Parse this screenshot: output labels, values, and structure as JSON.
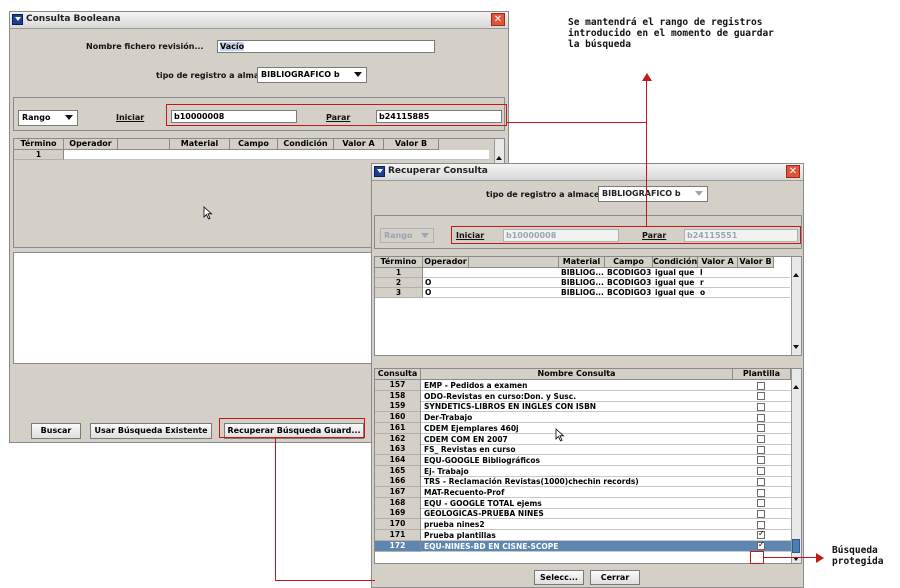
{
  "annotations": {
    "top_note_lines": [
      "Se mantendrá el rango de registros",
      "introducido en el momento de guardar",
      "la búsqueda"
    ],
    "bottom_note_lines": [
      "Búsqueda",
      "protegida"
    ]
  },
  "win1": {
    "title": "Consulta Booleana",
    "revision_label": "Nombre fichero revisión...",
    "revision_value": "Vacío",
    "record_type_label": "tipo de registro a almace...",
    "record_type_value": "BIBLIOGRAFICO b",
    "range_label": "Rango",
    "start_label": "Iniciar",
    "start_value": "b10000008",
    "stop_label": "Parar",
    "stop_value": "b24115885",
    "columns": [
      "Término",
      "Operador",
      "",
      "Material",
      "Campo",
      "Condición",
      "Valor A",
      "Valor B"
    ],
    "first_row_num": "1",
    "buttons": {
      "search": "Buscar",
      "use_existing": "Usar Búsqueda Existente",
      "recover": "Recuperar Búsqueda Guard..."
    }
  },
  "win2": {
    "title": "Recuperar Consulta",
    "record_type_label": "tipo de registro a almace...",
    "record_type_value": "BIBLIOGRAFICO b",
    "range_label": "Rango",
    "start_label": "Iniciar",
    "start_value": "b10000008",
    "stop_label": "Parar",
    "stop_value": "b24115551",
    "columns": [
      "Término",
      "Operador",
      "",
      "Material",
      "Campo",
      "Condición",
      "Valor A",
      "Valor B"
    ],
    "rows": [
      {
        "term": "1",
        "op": "",
        "material": "BIBLIOG...",
        "campo": "BCODIGO3",
        "cond": "igual que",
        "va": "l",
        "vb": ""
      },
      {
        "term": "2",
        "op": "O",
        "material": "BIBLIOG...",
        "campo": "BCODIGO3",
        "cond": "igual que",
        "va": "r",
        "vb": ""
      },
      {
        "term": "3",
        "op": "O",
        "material": "BIBLIOG...",
        "campo": "BCODIGO3",
        "cond": "igual que",
        "va": "o",
        "vb": ""
      }
    ],
    "query_columns": [
      "Consulta",
      "Nombre Consulta",
      "Plantilla"
    ],
    "queries": [
      {
        "num": "157",
        "name": "EMP - Pedidos a examen",
        "template": false
      },
      {
        "num": "158",
        "name": "ODO-Revistas en curso:Don. y Susc.",
        "template": false
      },
      {
        "num": "159",
        "name": "SYNDETICS-LIBROS EN INGLES CON ISBN",
        "template": false
      },
      {
        "num": "160",
        "name": "Der-Trabajo",
        "template": false
      },
      {
        "num": "161",
        "name": "CDEM Ejemplares 460j",
        "template": false
      },
      {
        "num": "162",
        "name": "CDEM COM EN 2007",
        "template": false
      },
      {
        "num": "163",
        "name": "FS_ Revistas en curso",
        "template": false
      },
      {
        "num": "164",
        "name": "EQU-GOOGLE Bibliográficos",
        "template": false
      },
      {
        "num": "165",
        "name": "Ej- Trabajo",
        "template": false
      },
      {
        "num": "166",
        "name": "TRS - Reclamación Revistas(1000)chechin records)",
        "template": false
      },
      {
        "num": "167",
        "name": "MAT-Recuento-Prof",
        "template": false
      },
      {
        "num": "168",
        "name": "EQU - GOOGLE TOTAL ejems",
        "template": false
      },
      {
        "num": "169",
        "name": "GEOLOGICAS-PRUEBA NINES",
        "template": false
      },
      {
        "num": "170",
        "name": "prueba nines2",
        "template": false
      },
      {
        "num": "171",
        "name": "Prueba plantillas",
        "template": true
      },
      {
        "num": "172",
        "name": "EQU-NINES-BD EN CISNE-SCOPE",
        "template": true
      }
    ],
    "buttons": {
      "select": "Selecc...",
      "close": "Cerrar"
    }
  }
}
